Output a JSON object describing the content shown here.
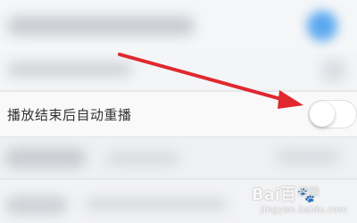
{
  "setting": {
    "label": "播放结束后自动重播",
    "toggle_state": "off"
  },
  "watermark": {
    "logo": "Bai百",
    "subtitle": "经验",
    "url": "jingyan.baidu.com"
  },
  "colors": {
    "arrow": "#e0282e",
    "label_text": "#333333",
    "toggle_border": "#dedfe2",
    "blurred_accent": "#5aa9ee"
  },
  "icons": {
    "watermark_paw": "paw-icon",
    "annotation": "arrow-icon"
  }
}
